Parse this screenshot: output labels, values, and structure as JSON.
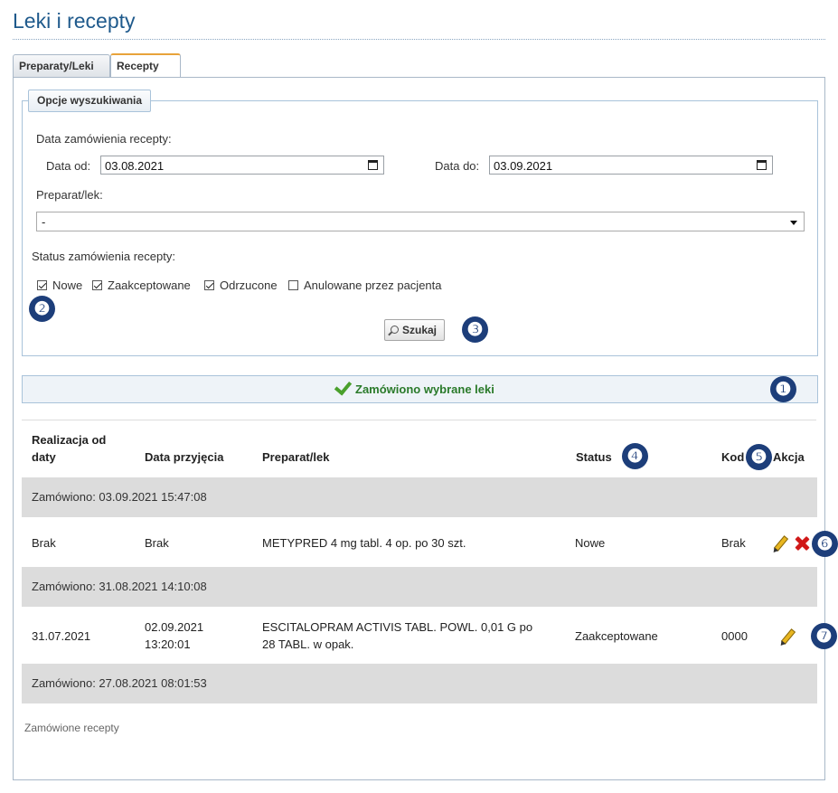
{
  "page": {
    "title": "Leki i recepty"
  },
  "tabs": [
    {
      "label": "Preparaty/Leki",
      "active": false
    },
    {
      "label": "Recepty",
      "active": true
    }
  ],
  "search": {
    "legend": "Opcje wyszukiwania",
    "date_group_label": "Data zamówienia recepty:",
    "date_from_label": "Data od:",
    "date_from_value": "03.08.2021",
    "date_to_label": "Data do:",
    "date_to_value": "03.09.2021",
    "preparat_label": "Preparat/lek:",
    "preparat_value": "-",
    "status_label": "Status zamówienia recepty:",
    "statuses": [
      {
        "label": "Nowe",
        "checked": true
      },
      {
        "label": "Zaakceptowane",
        "checked": true
      },
      {
        "label": "Odrzucone",
        "checked": true
      },
      {
        "label": "Anulowane przez pacjenta",
        "checked": false
      }
    ],
    "button_label": "Szukaj"
  },
  "message": {
    "text": "Zamówiono wybrane leki"
  },
  "badges": [
    "❶",
    "❷",
    "❸",
    "❹",
    "❺",
    "❻",
    "❼"
  ],
  "table": {
    "headers": {
      "realizacja": "Realizacja od daty",
      "realizacja_line1": "Realizacja od",
      "realizacja_line2": "daty",
      "data_przyjecia": "Data przyjęcia",
      "preparat": "Preparat/lek",
      "status": "Status",
      "kod": "Kod",
      "akcja": "Akcja"
    },
    "groups": [
      {
        "label": "Zamówiono: 03.09.2021 15:47:08",
        "rows": [
          {
            "realizacja": "Brak",
            "data_przyjecia": "Brak",
            "preparat": "METYPRED 4 mg tabl. 4 op. po 30 szt.",
            "status": "Nowe",
            "kod": "Brak"
          }
        ]
      },
      {
        "label": "Zamówiono: 31.08.2021 14:10:08",
        "rows": [
          {
            "realizacja": "31.07.2021",
            "data_przyjecia_line1": "02.09.2021",
            "data_przyjecia_line2": "13:20:01",
            "preparat_line1": "ESCITALOPRAM ACTIVIS TABL. POWL. 0,01 G po",
            "preparat_line2": "28 TABL. w opak.",
            "status": "Zaakceptowane",
            "kod": "0000"
          }
        ]
      },
      {
        "label": "Zamówiono: 27.08.2021 08:01:53",
        "rows": []
      }
    ]
  },
  "footer": {
    "text": "Zamówione recepty"
  }
}
